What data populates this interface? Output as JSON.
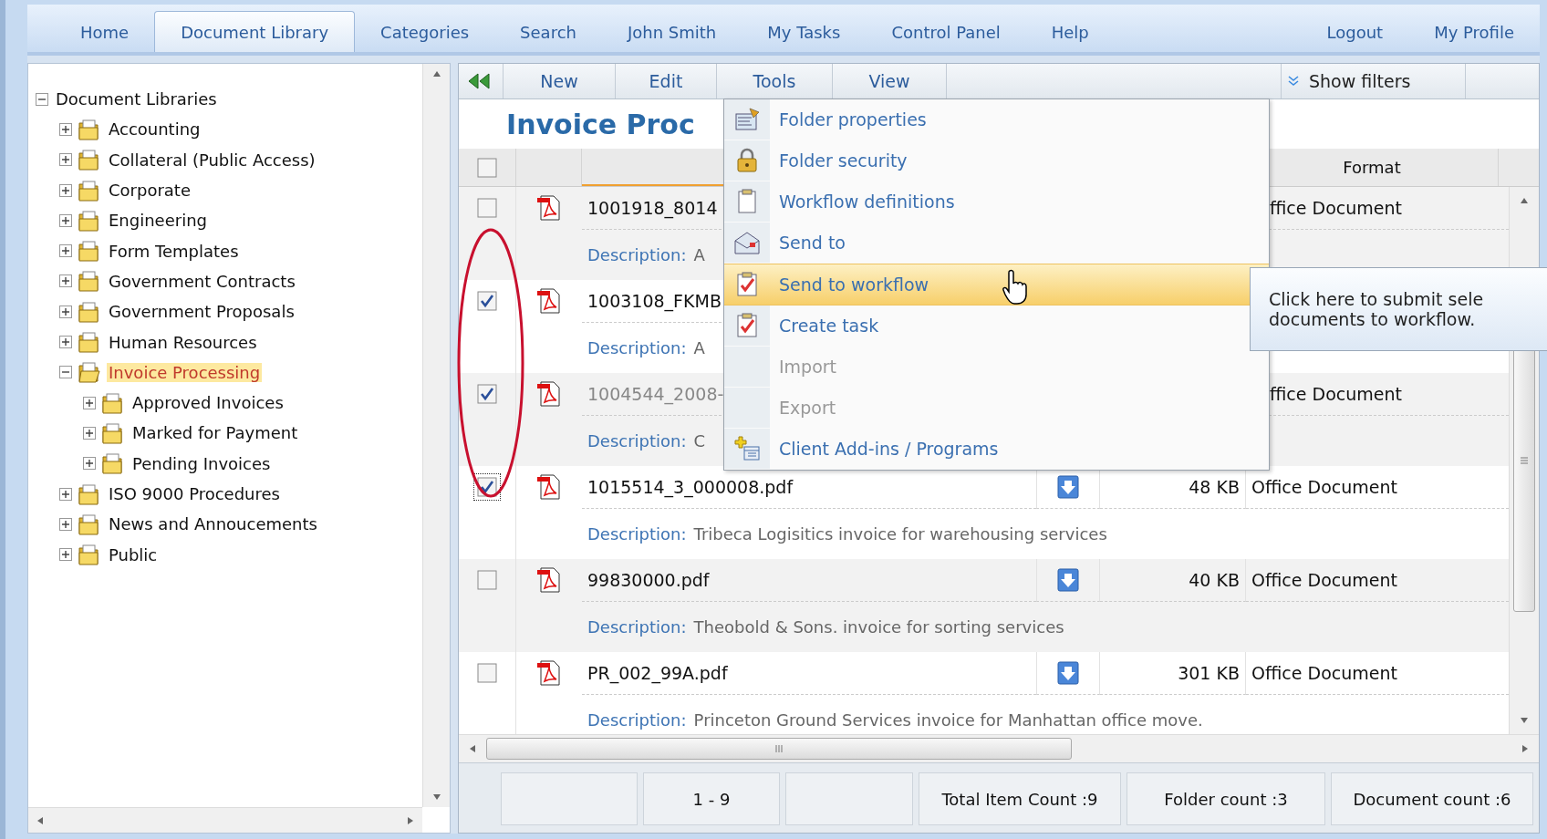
{
  "nav": {
    "tabs": [
      {
        "label": "Home",
        "selected": false
      },
      {
        "label": "Document Library",
        "selected": true
      },
      {
        "label": "Categories",
        "selected": false
      },
      {
        "label": "Search",
        "selected": false
      },
      {
        "label": "John Smith",
        "selected": false
      },
      {
        "label": "My Tasks",
        "selected": false
      },
      {
        "label": "Control Panel",
        "selected": false
      },
      {
        "label": "Help",
        "selected": false
      }
    ],
    "right_links": [
      "Logout",
      "My Profile"
    ]
  },
  "tree": {
    "label": "Document Libraries",
    "expanded": true,
    "children": [
      {
        "label": "Accounting",
        "expanded": false,
        "selected": false
      },
      {
        "label": "Collateral (Public Access)",
        "expanded": false,
        "selected": false
      },
      {
        "label": "Corporate",
        "expanded": false,
        "selected": false
      },
      {
        "label": "Engineering",
        "expanded": false,
        "selected": false
      },
      {
        "label": "Form Templates",
        "expanded": false,
        "selected": false
      },
      {
        "label": "Government Contracts",
        "expanded": false,
        "selected": false
      },
      {
        "label": "Government Proposals",
        "expanded": false,
        "selected": false
      },
      {
        "label": "Human Resources",
        "expanded": false,
        "selected": false
      },
      {
        "label": "Invoice Processing",
        "expanded": true,
        "selected": true,
        "children": [
          {
            "label": "Approved Invoices",
            "expanded": false,
            "selected": false
          },
          {
            "label": "Marked for Payment",
            "expanded": false,
            "selected": false
          },
          {
            "label": "Pending Invoices",
            "expanded": false,
            "selected": false
          }
        ]
      },
      {
        "label": "ISO 9000 Procedures",
        "expanded": false,
        "selected": false
      },
      {
        "label": "News and Annoucements",
        "expanded": false,
        "selected": false
      },
      {
        "label": "Public",
        "expanded": false,
        "selected": false
      }
    ]
  },
  "toolbar": {
    "buttons": [
      "New",
      "Edit",
      "Tools",
      "View"
    ],
    "filters": "Show filters"
  },
  "title": "Invoice Proc",
  "table": {
    "columns": {
      "format": "Format"
    },
    "header_checked": false,
    "rows": [
      {
        "name": "1001918_8014",
        "dimmed": false,
        "checked": false,
        "format": "ffice Document",
        "desc_label": "Description:",
        "desc": "A"
      },
      {
        "name": "1003108_FKMB",
        "dimmed": false,
        "checked": true,
        "desc_label": "Description:",
        "desc": "A"
      },
      {
        "name": "1004544_2008-",
        "dimmed": true,
        "checked": true,
        "format": "ffice Document",
        "desc_label": "Description:",
        "desc": "C"
      },
      {
        "name": "1015514_3_000008.pdf",
        "dimmed": false,
        "checked": true,
        "size": "48 KB",
        "format": "Office Document",
        "desc_label": "Description:",
        "desc": "Tribeca Logisitics invoice for warehousing services"
      },
      {
        "name": "99830000.pdf",
        "dimmed": false,
        "checked": false,
        "size": "40 KB",
        "format": "Office Document",
        "desc_label": "Description:",
        "desc": "Theobold & Sons. invoice for sorting services"
      },
      {
        "name": "PR_002_99A.pdf",
        "dimmed": false,
        "checked": false,
        "size": "301 KB",
        "format": "Office Document",
        "desc_label": "Description:",
        "desc": "Princeton Ground Services invoice for Manhattan office move."
      }
    ]
  },
  "menu": {
    "items": [
      {
        "label": "Folder properties",
        "disabled": false,
        "selected": false
      },
      {
        "label": "Folder security",
        "disabled": false,
        "selected": false
      },
      {
        "label": "Workflow definitions",
        "disabled": false,
        "selected": false
      },
      {
        "label": "Send to",
        "disabled": false,
        "selected": false
      },
      {
        "label": "Send to workflow",
        "disabled": false,
        "selected": true
      },
      {
        "label": "Create task",
        "disabled": false,
        "selected": false
      },
      {
        "label": "Import",
        "disabled": true,
        "selected": false
      },
      {
        "label": "Export",
        "disabled": true,
        "selected": false
      },
      {
        "label": "Client Add-ins / Programs",
        "disabled": false,
        "selected": false
      }
    ]
  },
  "tooltip": {
    "lines": [
      "Click here to submit sele",
      "documents to workflow."
    ]
  },
  "status_bar": {
    "range": "1 - 9",
    "total": "Total Item Count :9",
    "folders": "Folder count :3",
    "documents": "Document count :6"
  }
}
